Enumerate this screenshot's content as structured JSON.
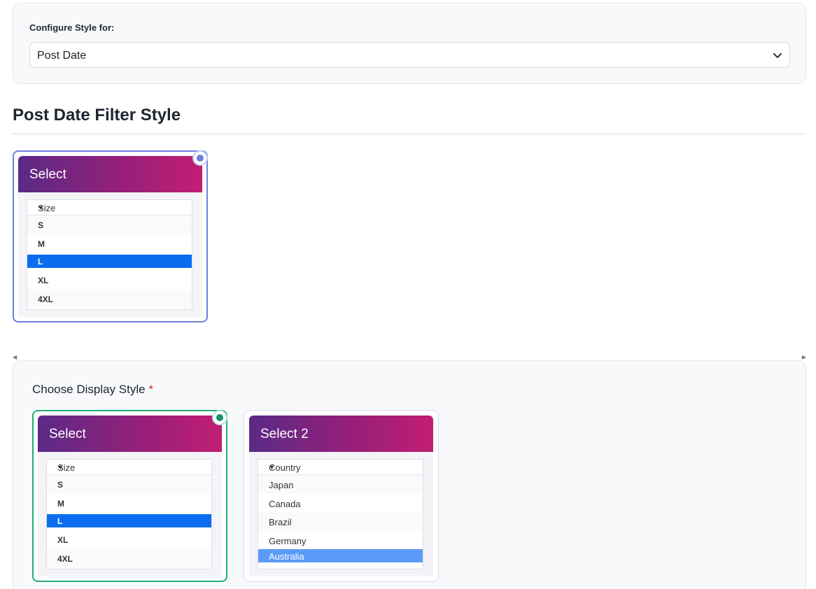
{
  "config": {
    "label": "Configure Style for:",
    "selected": "Post Date"
  },
  "section": {
    "title": "Post Date Filter Style"
  },
  "preview_card": {
    "header": "Select",
    "dropdown": {
      "placeholder": "Size",
      "options": [
        "S",
        "M",
        "L",
        "XL",
        "4XL"
      ],
      "highlighted": "L"
    }
  },
  "display": {
    "label": "Choose Display Style",
    "required_mark": "*",
    "cards": [
      {
        "header": "Select",
        "selected": true,
        "dropdown": {
          "placeholder": "Size",
          "options": [
            "S",
            "M",
            "L",
            "XL",
            "4XL"
          ],
          "highlighted": "L"
        }
      },
      {
        "header": "Select 2",
        "selected": false,
        "dropdown": {
          "placeholder": "Country",
          "options": [
            "Japan",
            "Canada",
            "Brazil",
            "Germany",
            "Australia"
          ],
          "highlighted": "Australia"
        }
      }
    ]
  },
  "colors": {
    "accent_blue": "#6f7fe0",
    "accent_green": "#1fb07a",
    "highlight": "#0a6df0"
  }
}
